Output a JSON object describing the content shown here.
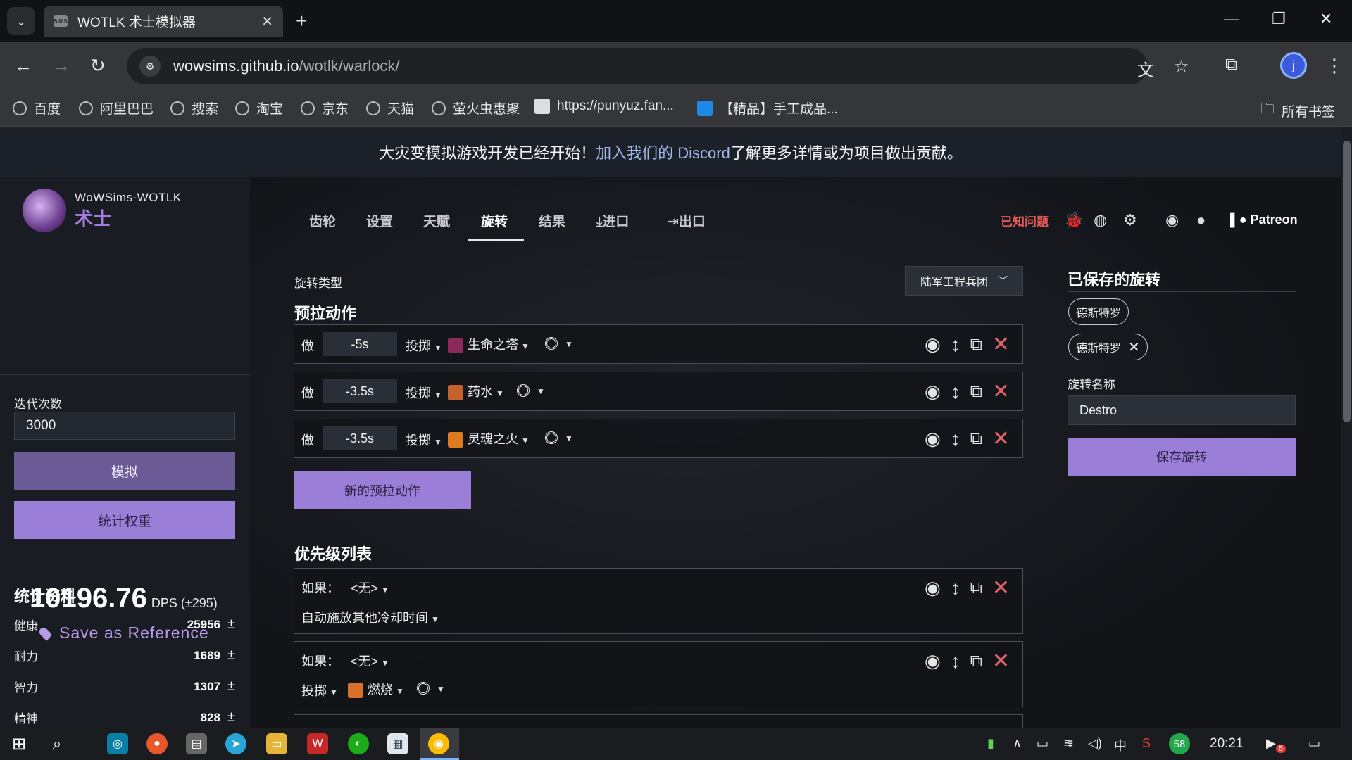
{
  "browser": {
    "tab_title": "WOTLK 术士模拟器",
    "tab_favicon_text": "SIMS",
    "url_host": "wowsims.github.io",
    "url_path": "/wotlk/warlock/",
    "profile_initial": "j",
    "bookmarks": [
      "百度",
      "阿里巴巴",
      "搜索",
      "淘宝",
      "京东",
      "天猫",
      "萤火虫惠聚",
      "https://punyuz.fan...",
      "【精品】手工成品..."
    ],
    "all_bookmarks": "所有书签"
  },
  "banner": {
    "before": "大灾变模拟游戏开发已经开始！",
    "link": "加入我们的 Discord",
    "after": "了解更多详情或为项目做出贡献。"
  },
  "sidebar": {
    "site_name": "WoWSims-WOTLK",
    "class_name": "术士",
    "iterations_label": "迭代次数",
    "iterations_value": "3000",
    "simulate_label": "模拟",
    "stat_weights_label": "统计权重",
    "dps_value": "10196.76",
    "dps_unit": "DPS (±295)",
    "save_reference": "Save as Reference",
    "stats_title": "统计资料",
    "stats": [
      {
        "name": "健康",
        "value": "25956"
      },
      {
        "name": "耐力",
        "value": "1689"
      },
      {
        "name": "智力",
        "value": "1307"
      },
      {
        "name": "精神",
        "value": "828"
      }
    ],
    "plus_minus": "±"
  },
  "nav": {
    "tabs": [
      "齿轮",
      "设置",
      "天赋",
      "旋转",
      "结果",
      "进口",
      "出口"
    ],
    "active_tab": "旋转",
    "known_issues": "已知问题",
    "patreon": "Patreon"
  },
  "rotation": {
    "type_label": "旋转类型",
    "type_value": "陆军工程兵团",
    "prepull_title": "预拉动作",
    "do_label": "做",
    "cast_label": "投掷",
    "prepull": [
      {
        "time": "-5s",
        "spell": "生命之塔",
        "color": "#8b2a5a"
      },
      {
        "time": "-3.5s",
        "spell": "药水",
        "color": "#c4622d"
      },
      {
        "time": "-3.5s",
        "spell": "灵魂之火",
        "color": "#e07a20"
      }
    ],
    "new_prepull": "新的预拉动作",
    "priority_title": "优先级列表",
    "if_label": "如果：",
    "none_label": "<无>",
    "priority": [
      {
        "action_text": "自动施放其他冷却时间",
        "spell": ""
      },
      {
        "action_text": "",
        "spell": "燃烧"
      }
    ]
  },
  "saved": {
    "title": "已保存的旋转",
    "chips": [
      "德斯特罗",
      "德斯特罗"
    ],
    "name_label": "旋转名称",
    "name_value": "Destro",
    "save_button": "保存旋转"
  },
  "taskbar": {
    "time": "20:21",
    "ime": "中",
    "badge": "58",
    "notif": "5"
  },
  "colors": {
    "accent": "#9b7ed8",
    "danger": "#e0626a",
    "class_color": "#a67be0"
  }
}
